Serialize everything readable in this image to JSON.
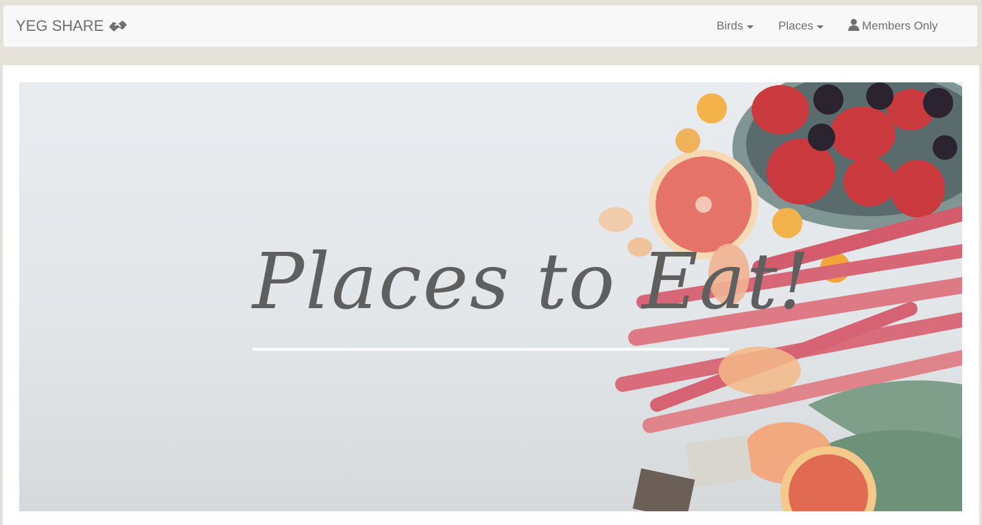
{
  "nav": {
    "brand": "YEG SHARE",
    "brand_icon": "handshake-icon",
    "items": [
      {
        "label": "Birds",
        "icon": "caret-down-icon"
      },
      {
        "label": "Places",
        "icon": "caret-down-icon"
      },
      {
        "label": "Members Only",
        "icon": "user-icon"
      }
    ]
  },
  "hero": {
    "title": "Places to Eat!",
    "image": "fruit-flat-lay-photo"
  },
  "colors": {
    "page_background": "#e5e0d8",
    "navbar_background": "#f8f8f8",
    "text": "#6f6f6f",
    "hero_title": "#5f5f5f"
  }
}
